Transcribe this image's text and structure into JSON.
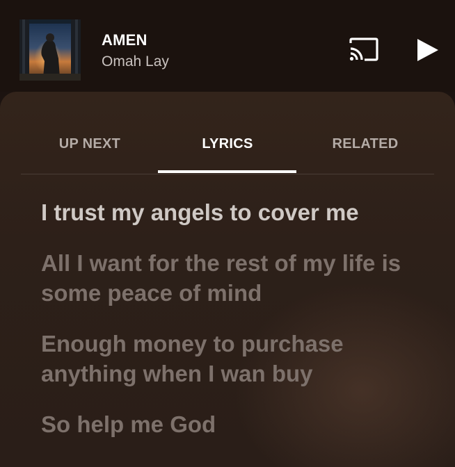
{
  "now_playing": {
    "title": "AMEN",
    "artist": "Omah Lay"
  },
  "controls": {
    "cast_icon": "cast-icon",
    "play_icon": "play-icon"
  },
  "tabs": [
    {
      "label": "UP NEXT",
      "active": false
    },
    {
      "label": "LYRICS",
      "active": true
    },
    {
      "label": "RELATED",
      "active": false
    }
  ],
  "lyrics": [
    {
      "text": "I trust my angels to cover me",
      "current": true
    },
    {
      "text": "All I want for the rest of my life is some peace of mind",
      "current": false
    },
    {
      "text": "Enough money to purchase anything when I wan buy",
      "current": false
    },
    {
      "text": "So help me God",
      "current": false
    }
  ],
  "colors": {
    "background": "#1b120e",
    "sheet": "#2d2019",
    "accent": "#ffffff",
    "lyric_current": "#cfc9c5",
    "lyric_dim": "#7d716b"
  }
}
